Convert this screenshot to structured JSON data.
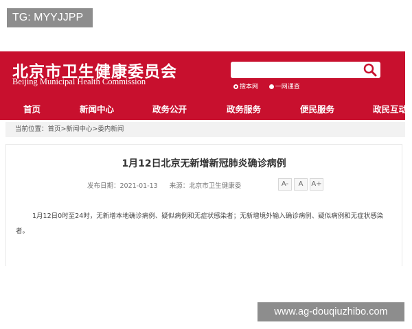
{
  "watermark_top": "TG: MYYJJPP",
  "watermark_bottom": "www.ag-douqiuzhibo.com",
  "header": {
    "logo_cn": "北京市卫生健康委员会",
    "logo_en": "Beijing Municipal Health Commission",
    "accent_color": "#c8102e",
    "search": {
      "value": "",
      "icon": "search-icon",
      "options": [
        {
          "label": "搜本网",
          "selected": true
        },
        {
          "label": "一网通查",
          "selected": false
        }
      ]
    }
  },
  "nav": {
    "items": [
      "首页",
      "新闻中心",
      "政务公开",
      "政务服务",
      "便民服务",
      "政民互动"
    ]
  },
  "breadcrumb": "当前位置：首页>新闻中心>委内新闻",
  "article": {
    "title": "1月12日北京无新增新冠肺炎确诊病例",
    "publish_date": "发布日期：2021-01-13",
    "source": "来源：北京市卫生健康委",
    "font_buttons": [
      "A-",
      "A",
      "A+"
    ],
    "body": "1月12日0时至24时，无新增本地确诊病例、疑似病例和无症状感染者；无新增境外输入确诊病例、疑似病例和无症状感染者。"
  }
}
